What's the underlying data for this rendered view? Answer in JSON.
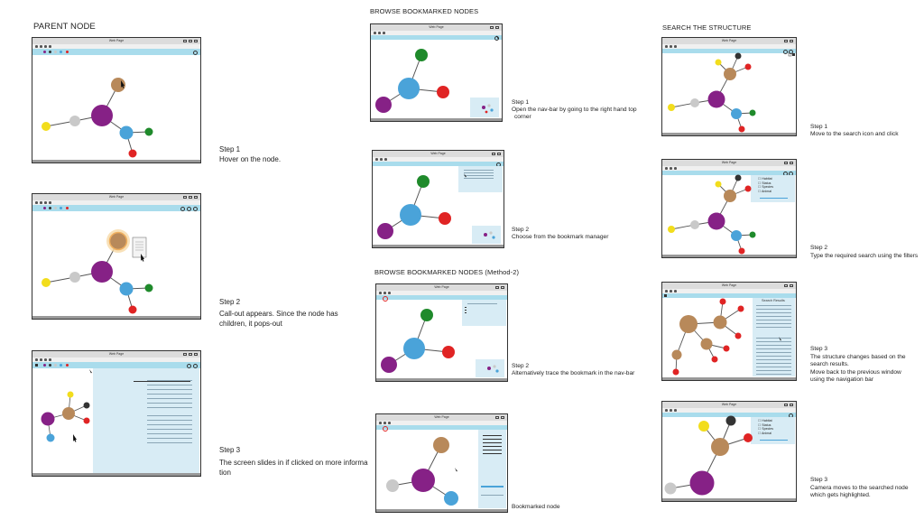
{
  "columns": [
    {
      "heading": "PARENT NODE"
    },
    {
      "heading": "BROWSE BOOKMARKED NODES",
      "heading2": "BROWSE BOOKMARKED NODES  (Method-2)"
    },
    {
      "heading": "SEARCH THE STRUCTURE"
    }
  ],
  "window_title": "Web Page",
  "captions": {
    "c1s1": {
      "step": "Step 1",
      "text": "Hover on the node."
    },
    "c1s2": {
      "step": "Step 2",
      "text1": "Call-out appears. Since the node has",
      "text2": "children, it pops-out"
    },
    "c1s3": {
      "step": "Step 3",
      "text1": "The screen slides in if clicked on more informa",
      "text2": "tion"
    },
    "c2s1": {
      "step": "Step 1",
      "text1": "Open the nav-bar by going to the right hand top",
      "text2": "corner"
    },
    "c2s2": {
      "step": "Step 2",
      "text1": "Choose from the bookmark manager"
    },
    "c2s3": {
      "step": "Step 2",
      "text1": "Alternatively trace the bookmark in the nav-bar"
    },
    "c2s4": {
      "text1": "Bookmarked node"
    },
    "c3s1": {
      "step": "Step 1",
      "text1": "Move to the search icon and click"
    },
    "c3s2": {
      "step": "Step 2",
      "text1": "Type the required search using the filters"
    },
    "c3s3": {
      "step": "Step 3",
      "text1": "The structure changes based on the",
      "text2": "search results.",
      "text3": "Move back to the previous window",
      "text4": "using the navigation bar"
    },
    "c3s4": {
      "step": "Step 3",
      "text1": "Camera moves to the searched node",
      "text2": "which gets highlighted."
    }
  },
  "filters": [
    "Habitat",
    "Status",
    "Species",
    "Animal"
  ],
  "search_results_label": "Search Results",
  "colors": {
    "purple": "#862186",
    "blue": "#4aa3d9",
    "tan": "#b8895a",
    "yellow": "#f2dd1c",
    "grey": "#c9c9c9",
    "red": "#e02424",
    "green": "#1f8a2b",
    "navbar": "#a9dcec",
    "panel": "#d8ecf5",
    "black": "#333333"
  }
}
